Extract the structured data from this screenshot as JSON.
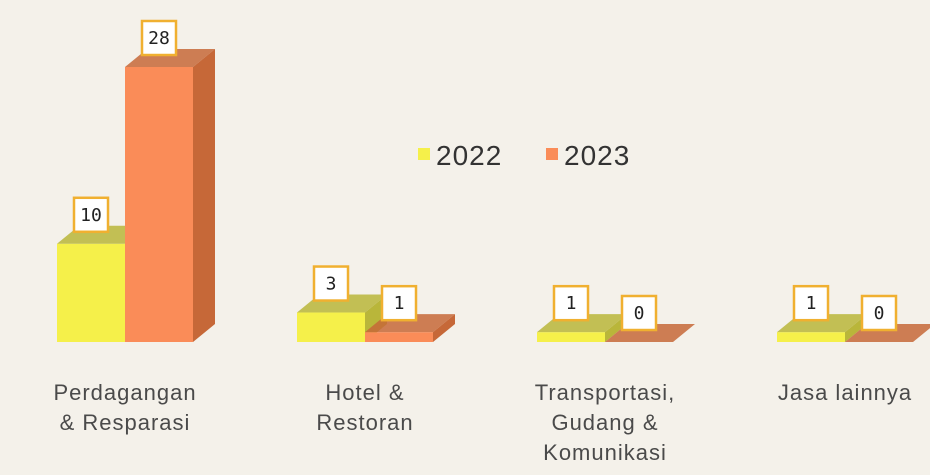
{
  "chart_data": {
    "type": "bar",
    "style": "3d-clustered",
    "categories": [
      [
        "Perdagangan",
        "& Resparasi"
      ],
      [
        "Hotel &",
        "Restoran"
      ],
      [
        "Transportasi,",
        "Gudang &",
        "Komunikasi"
      ],
      [
        "Jasa lainnya"
      ]
    ],
    "series": [
      {
        "name": "2022",
        "values": [
          10,
          3,
          1,
          1
        ],
        "color": "#f5f04a",
        "side_color": "#b9b63a"
      },
      {
        "name": "2023",
        "values": [
          28,
          1,
          0,
          0
        ],
        "color": "#fa8c58",
        "side_color": "#c66838"
      }
    ],
    "data_labels": [
      [
        "10",
        "3",
        "1",
        "1"
      ],
      [
        "28",
        "1",
        "0",
        "0"
      ]
    ],
    "ylim": [
      0,
      28
    ],
    "grid": false,
    "legend": "center"
  }
}
